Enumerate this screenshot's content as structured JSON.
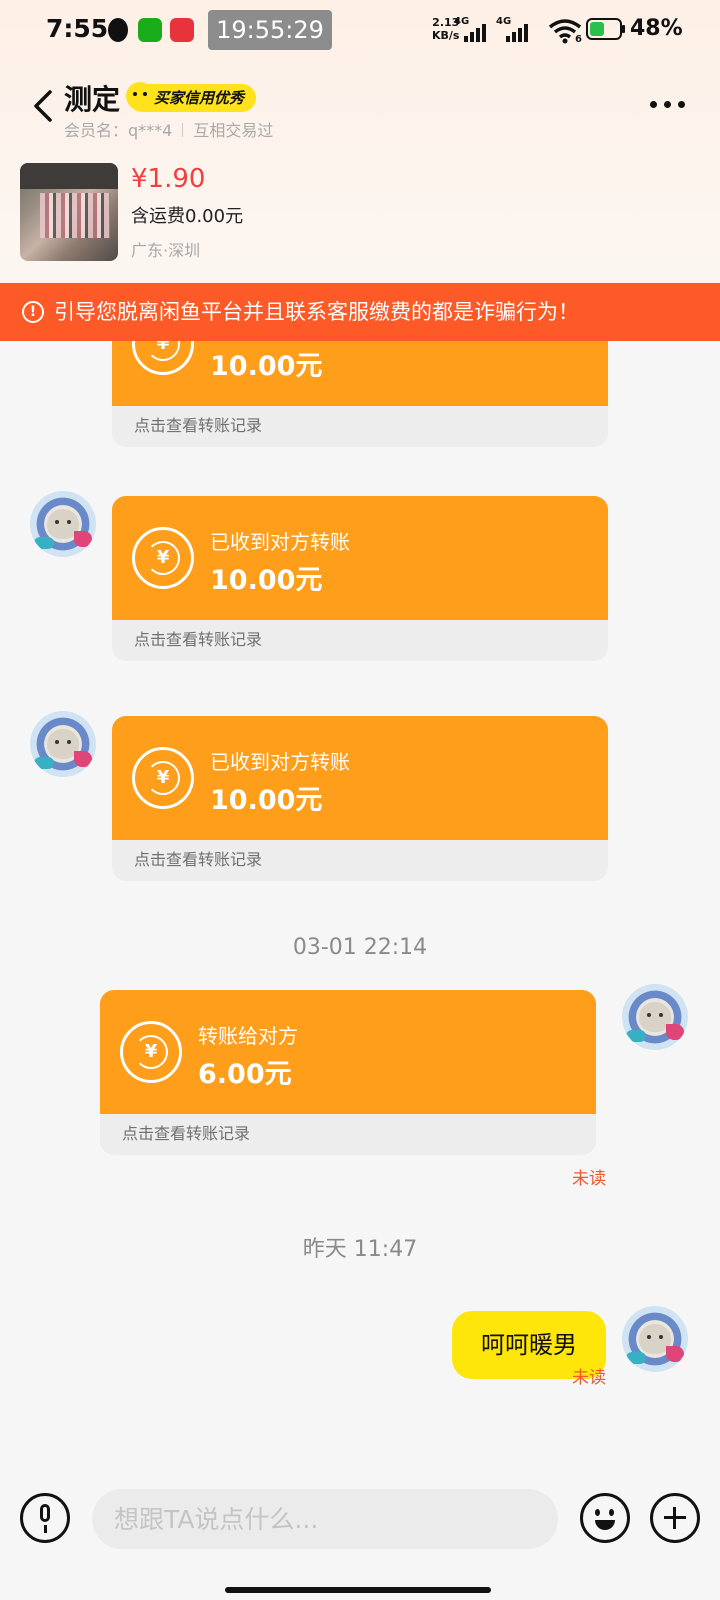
{
  "status_bar": {
    "time": "7:55",
    "dots": "···",
    "clock": "19:55:29",
    "net_speed": "2.13",
    "net_unit": "KB/s",
    "signal_1": "4G",
    "signal_2": "4G",
    "wifi_level": "6",
    "battery": "48%"
  },
  "header": {
    "title": "测定",
    "credit_badge": "买家信用优秀",
    "member_label": "会员名：",
    "member_name": "q***4",
    "relation": "互相交易过"
  },
  "product": {
    "price": "¥1.90",
    "shipping": "含运费0.00元",
    "location": "广东·深圳"
  },
  "warning": {
    "icon": "!",
    "text": "引导您脱离闲鱼平台并且联系客服缴费的都是诈骗行为！"
  },
  "messages": {
    "partial_transfer": {
      "amount": "10.00元",
      "link": "点击查看转账记录"
    },
    "transfer_1": {
      "label": "已收到对方转账",
      "amount": "10.00元",
      "link": "点击查看转账记录"
    },
    "transfer_2": {
      "label": "已收到对方转账",
      "amount": "10.00元",
      "link": "点击查看转账记录"
    },
    "timestamp_1": "03-01 22:14",
    "transfer_sent": {
      "label": "转账给对方",
      "amount": "6.00元",
      "link": "点击查看转账记录",
      "status": "未读"
    },
    "timestamp_2": "昨天 11:47",
    "text_sent": {
      "text": "呵呵暖男",
      "status": "未读"
    }
  },
  "input": {
    "placeholder": "想跟TA说点什么..."
  },
  "colors": {
    "transfer_orange": "#ff9e1a",
    "warning_red": "#fe5a27",
    "bubble_yellow": "#ffe60a",
    "price_red": "#f23e3e"
  }
}
